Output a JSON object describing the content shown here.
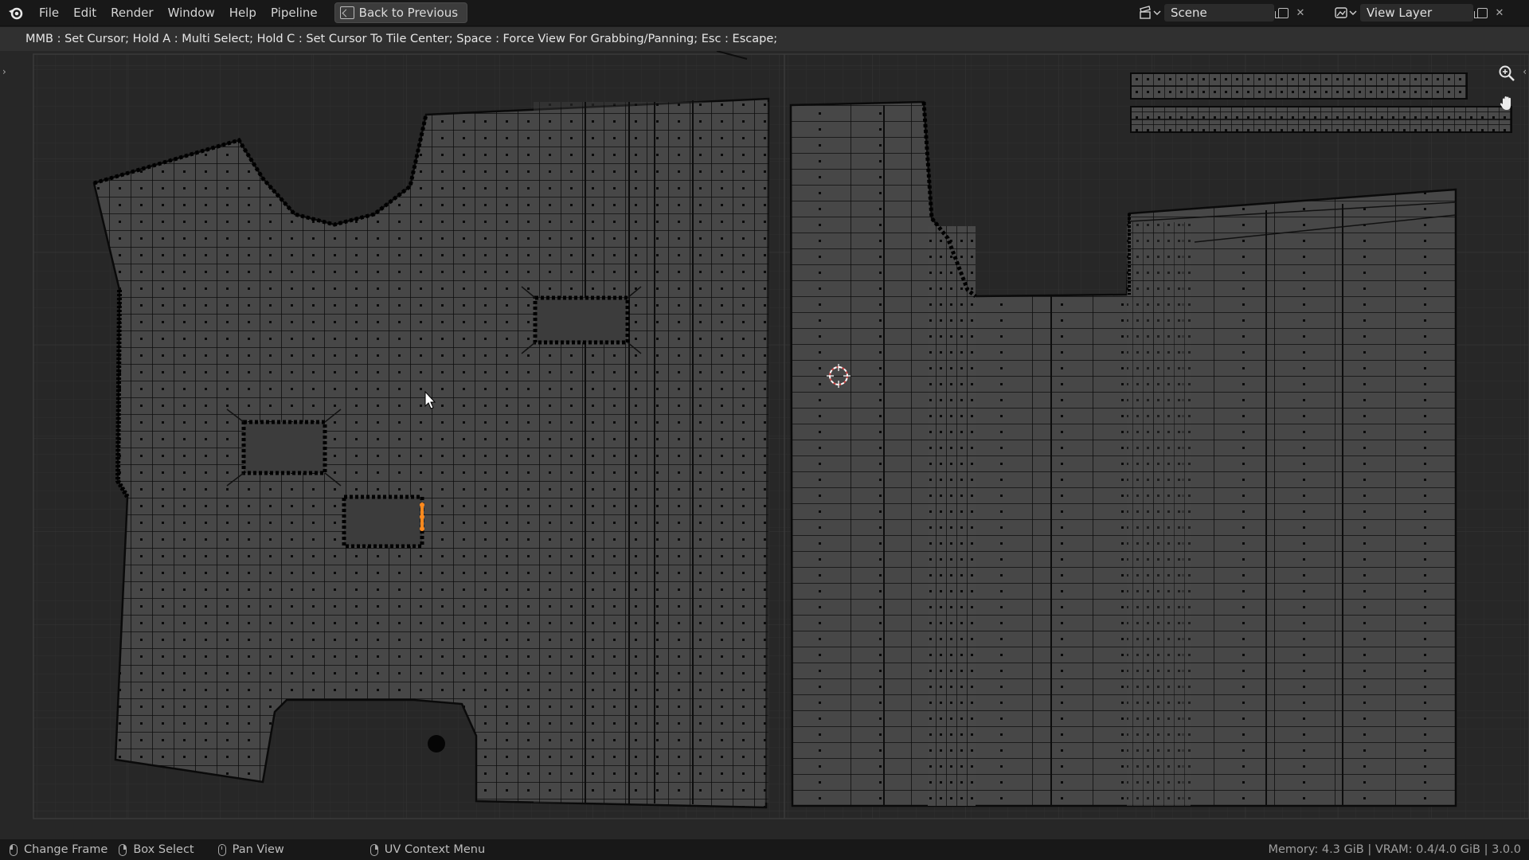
{
  "topbar": {
    "menu": [
      "File",
      "Edit",
      "Render",
      "Window",
      "Help",
      "Pipeline"
    ],
    "back_button": "Back to Previous",
    "scene": {
      "label": "Scene"
    },
    "view_layer": {
      "label": "View Layer"
    }
  },
  "header": {
    "hint": "MMB : Set Cursor; Hold A : Multi Select; Hold C : Set Cursor To Tile Center; Space : Force View For Grabbing/Panning; Esc : Escape;"
  },
  "viewport": {
    "icons": [
      "zoom-in-icon",
      "hand-pan-icon",
      "uv-cursor-icon",
      "mouse-pointer-icon"
    ],
    "colors": {
      "background": "#272727",
      "uv_face_fill": "#454545",
      "edge": "#0c0c0c",
      "selected": "#ff8a1e"
    }
  },
  "statusbar": {
    "items": [
      "Change Frame",
      "Box Select",
      "Pan View",
      "UV Context Menu"
    ],
    "memory": "Memory: 4.3 GiB | VRAM: 0.4/4.0 GiB | 3.0.0"
  }
}
